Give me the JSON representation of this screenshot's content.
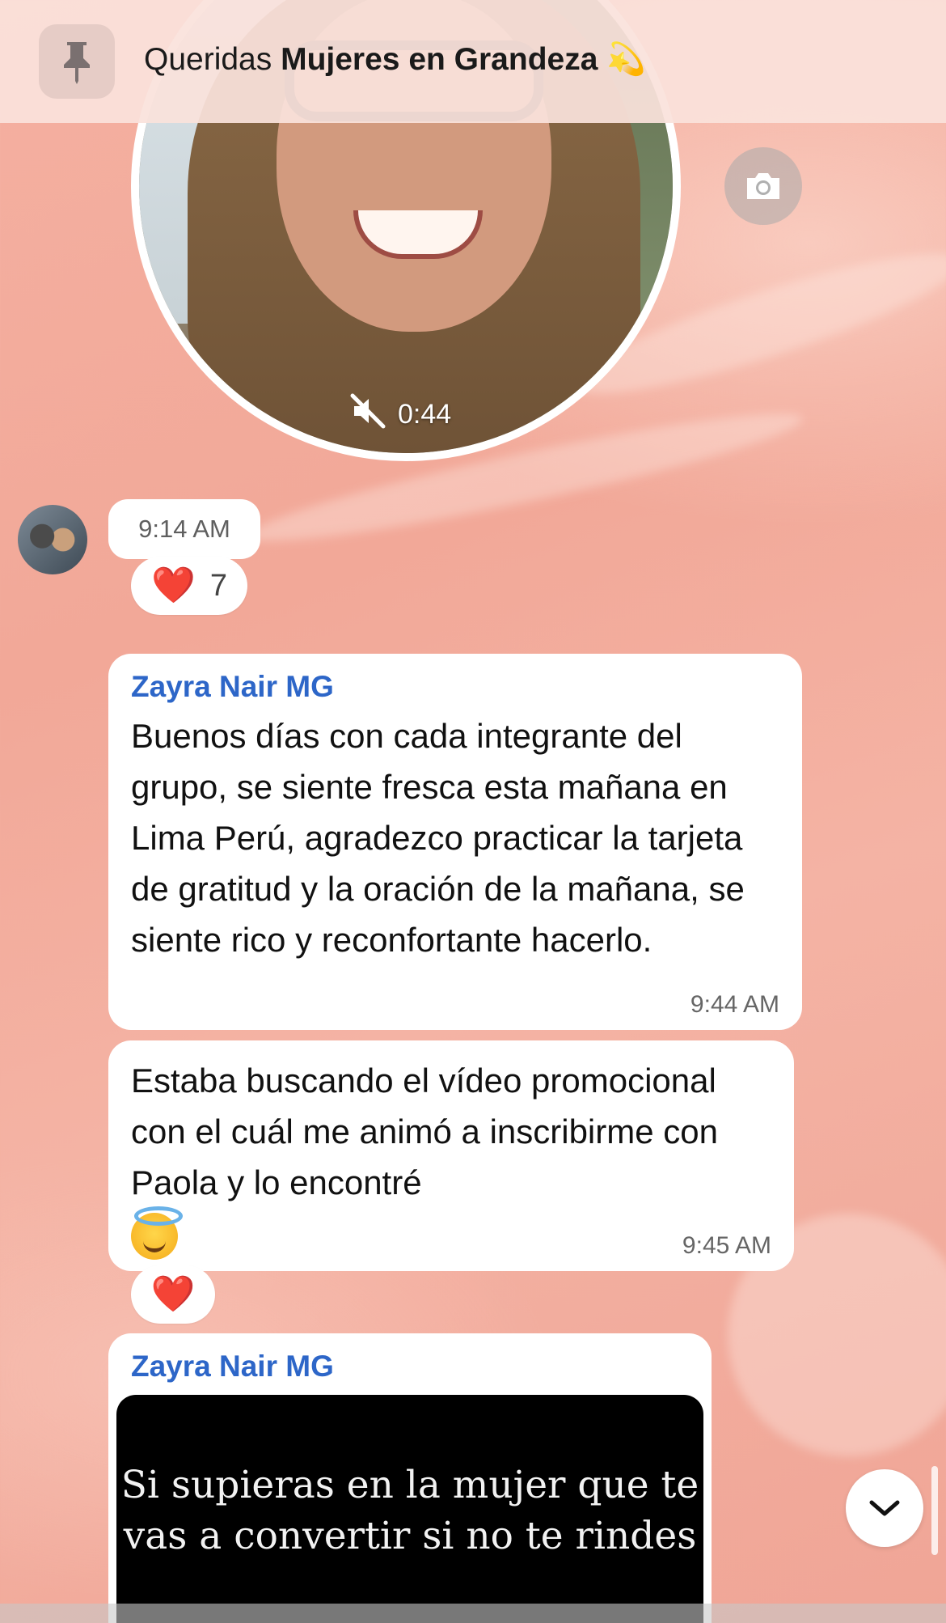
{
  "pinned": {
    "prefix": "Queridas ",
    "title_bold": "Mujeres en Grandeza",
    "emoji": "💫"
  },
  "video_note": {
    "duration": "0:44",
    "muted": true
  },
  "message_1": {
    "time": "9:14 AM",
    "reaction": {
      "emoji": "❤️",
      "count": "7"
    }
  },
  "message_2": {
    "sender": "Zayra Nair MG",
    "text": "Buenos días con cada integrante del grupo, se siente fresca esta mañana en Lima Perú, agradezco practicar la tarjeta de gratitud y la oración de la mañana, se siente rico y reconfortante hacerlo.",
    "time": "9:44 AM"
  },
  "message_3": {
    "text": "Estaba buscando el vídeo promocional con el cuál me animó a inscribirme con Paola y lo encontré",
    "emoji": "😇",
    "time": "9:45 AM",
    "reaction": {
      "emoji": "❤️"
    }
  },
  "message_4": {
    "sender": "Zayra Nair MG",
    "image_text": "Si supieras en la mujer que te vas a convertir si no te rindes"
  },
  "icons": {
    "pin": "pin-icon",
    "camera": "camera-icon",
    "mute": "muted-speaker-icon",
    "scroll": "chevron-down-icon"
  },
  "colors": {
    "sender": "#2d66c8",
    "background": "#f2a898",
    "heart": "#e0283c"
  }
}
